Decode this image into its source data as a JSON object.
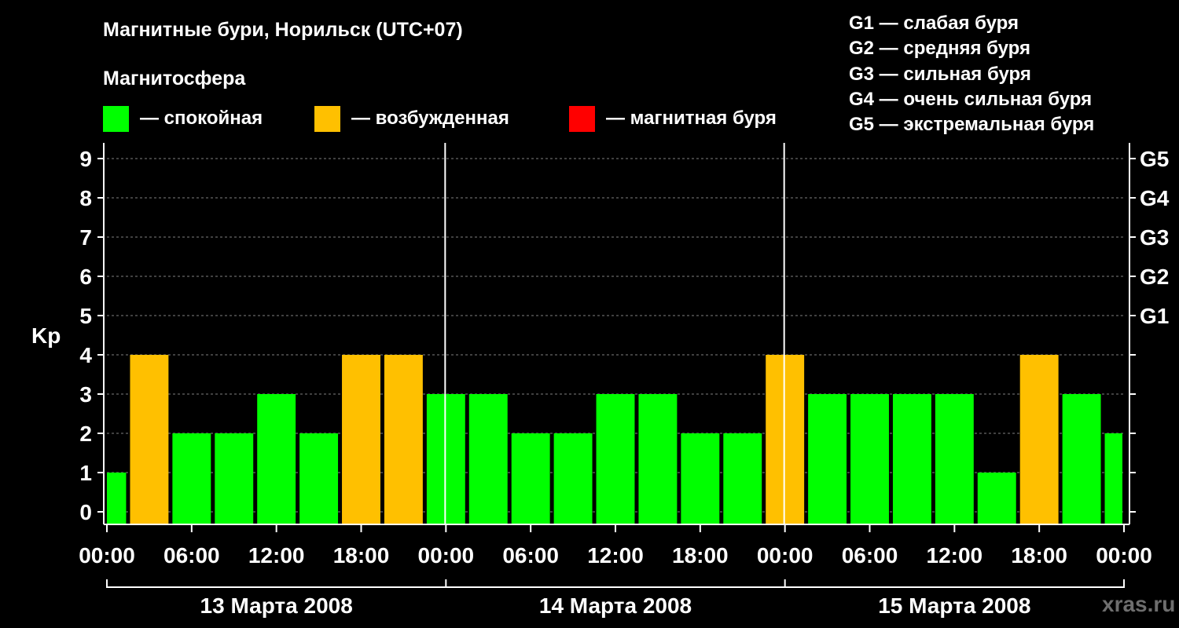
{
  "header": {
    "title": "Магнитные бури, Норильск (UTC+07)",
    "subtitle": "Магнитосфера"
  },
  "legend": {
    "items": [
      {
        "label": "— спокойная",
        "color": "#00ff00"
      },
      {
        "label": "— возбужденная",
        "color": "#ffc000"
      },
      {
        "label": "— магнитная буря",
        "color": "#ff0000"
      }
    ]
  },
  "g_legend": [
    "G1 — слабая буря",
    "G2 — средняя буря",
    "G3 — сильная буря",
    "G4 — очень сильная буря",
    "G5 — экстремальная буря"
  ],
  "watermark": "xras.ru",
  "colors": {
    "quiet": "#00ff00",
    "excited": "#ffc000",
    "storm": "#ff0000",
    "background": "#000000",
    "grid": "#808080"
  },
  "chart_data": {
    "type": "bar",
    "title": "Магнитные бури, Норильск (UTC+07)",
    "ylabel": "Kp",
    "ylim": [
      0,
      9
    ],
    "yticks": [
      "0",
      "1",
      "2",
      "3",
      "4",
      "5",
      "6",
      "7",
      "8",
      "9"
    ],
    "g_ticks": [
      {
        "level": 5,
        "label": "G1"
      },
      {
        "level": 6,
        "label": "G2"
      },
      {
        "level": 7,
        "label": "G3"
      },
      {
        "level": 8,
        "label": "G4"
      },
      {
        "level": 9,
        "label": "G5"
      }
    ],
    "xticks": [
      "00:00",
      "06:00",
      "12:00",
      "18:00",
      "00:00",
      "06:00",
      "12:00",
      "18:00",
      "00:00",
      "06:00",
      "12:00",
      "18:00",
      "00:00"
    ],
    "days": [
      "13 Марта 2008",
      "14 Марта 2008",
      "15 Марта 2008"
    ],
    "x_hours": [
      0,
      3,
      6,
      9,
      12,
      15,
      18,
      21,
      24,
      27,
      30,
      33,
      36,
      39,
      42,
      45,
      48,
      51,
      54,
      57,
      60,
      63,
      66,
      69,
      72
    ],
    "values": [
      1,
      4,
      2,
      2,
      3,
      2,
      4,
      4,
      3,
      3,
      2,
      2,
      3,
      3,
      2,
      2,
      4,
      3,
      3,
      3,
      3,
      1,
      4,
      3,
      2
    ],
    "status": [
      "quiet",
      "excited",
      "quiet",
      "quiet",
      "quiet",
      "quiet",
      "excited",
      "excited",
      "quiet",
      "quiet",
      "quiet",
      "quiet",
      "quiet",
      "quiet",
      "quiet",
      "quiet",
      "excited",
      "quiet",
      "quiet",
      "quiet",
      "quiet",
      "quiet",
      "excited",
      "quiet",
      "quiet"
    ],
    "grid": true,
    "legend_position": "top"
  }
}
